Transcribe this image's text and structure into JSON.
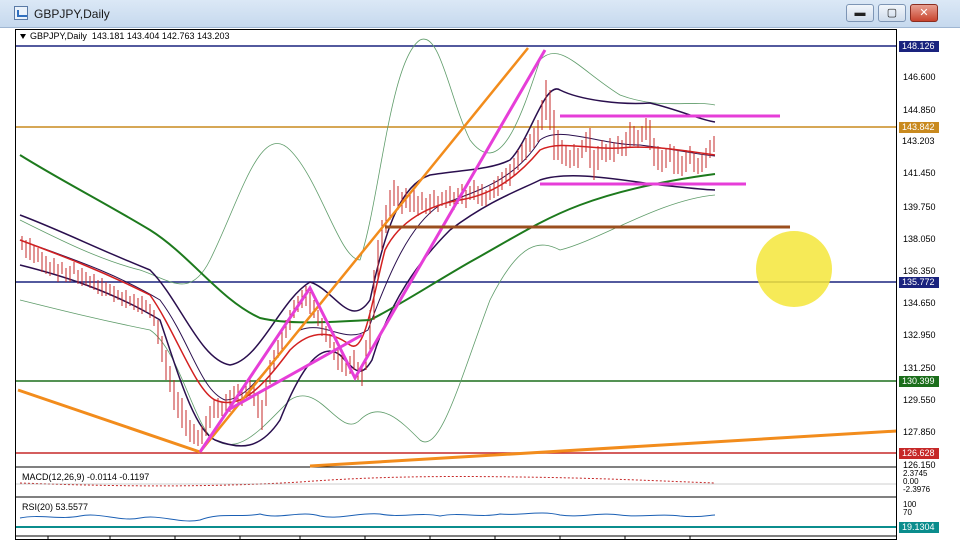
{
  "window": {
    "title": "GBPJPY,Daily",
    "minimize_label": "▬",
    "maximize_label": "▢",
    "close_label": "✕"
  },
  "chart": {
    "header": "GBPJPY,Daily  143.181 143.404 142.763 143.203",
    "price_scale": [
      "146.600",
      "144.850",
      "141.450",
      "139.750",
      "138.050",
      "136.350",
      "134.650",
      "132.950",
      "131.250",
      "129.550",
      "127.850",
      "126.150"
    ],
    "price_tags": [
      {
        "text": "148.126",
        "color": "#1a237e"
      },
      {
        "text": "143.842",
        "color": "#c98a1f"
      },
      {
        "text": "143.203",
        "color": "#000000"
      },
      {
        "text": "135.772",
        "color": "#1a237e"
      },
      {
        "text": "130.399",
        "color": "#1b6e1b"
      },
      {
        "text": "126.628",
        "color": "#c62828"
      }
    ]
  },
  "macd": {
    "label": "MACD(12,26,9) -0.0114 -0.1197",
    "scale": [
      "2.3745",
      "0.00",
      "-2.3976"
    ]
  },
  "rsi": {
    "label": "RSI(20) 53.5577",
    "scale": [
      "100",
      "70"
    ],
    "tag": "19.1304"
  },
  "colors": {
    "fib_line": "#f28c1c",
    "channel": "#e63ed8",
    "ma_green": "#1d7a1d",
    "ma_red": "#d32020",
    "bands": "#2a0f4e",
    "highlight": "#f5e63a"
  }
}
